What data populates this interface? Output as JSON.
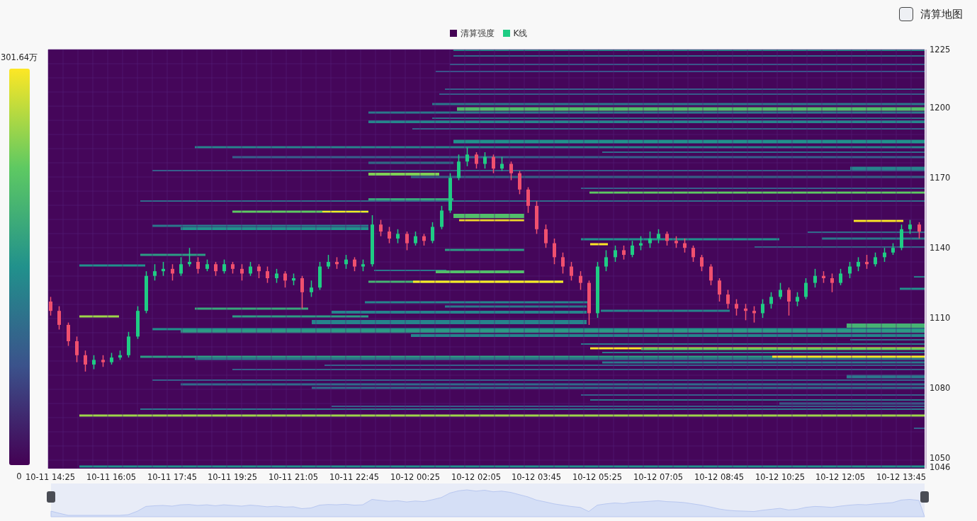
{
  "toggle": {
    "label": "清算地图",
    "checked": false
  },
  "legend": [
    {
      "label": "清算强度",
      "color": "#440154"
    },
    {
      "label": "K线",
      "color": "#1fcc84"
    }
  ],
  "color_scale": {
    "max_label": "301.64万",
    "min_label": "0"
  },
  "chart_data": {
    "type": "candlestick",
    "categories": [
      "10-11 14:25",
      null,
      null,
      null,
      null,
      null,
      null,
      "10-11 16:05",
      null,
      null,
      null,
      null,
      null,
      null,
      "10-11 17:45",
      null,
      null,
      null,
      null,
      null,
      null,
      "10-11 19:25",
      null,
      null,
      null,
      null,
      null,
      null,
      "10-11 21:05",
      null,
      null,
      null,
      null,
      null,
      null,
      "10-11 22:45",
      null,
      null,
      null,
      null,
      null,
      null,
      "10-12 00:25",
      null,
      null,
      null,
      null,
      null,
      null,
      "10-12 02:05",
      null,
      null,
      null,
      null,
      null,
      null,
      "10-12 03:45",
      null,
      null,
      null,
      null,
      null,
      null,
      "10-12 05:25",
      null,
      null,
      null,
      null,
      null,
      null,
      "10-12 07:05",
      null,
      null,
      null,
      null,
      null,
      null,
      "10-12 08:45",
      null,
      null,
      null,
      null,
      null,
      null,
      "10-12 10:25",
      null,
      null,
      null,
      null,
      null,
      null,
      "10-12 12:05",
      null,
      null,
      null,
      null,
      null,
      null,
      "10-12 13:45",
      null,
      null
    ],
    "ohlc": [
      [
        1117,
        1119,
        1111,
        1113
      ],
      [
        1113,
        1115,
        1105,
        1107
      ],
      [
        1107,
        1108,
        1098,
        1100
      ],
      [
        1100,
        1102,
        1091,
        1094
      ],
      [
        1094,
        1096,
        1087,
        1090
      ],
      [
        1090,
        1094,
        1088,
        1092
      ],
      [
        1092,
        1094,
        1089,
        1091
      ],
      [
        1091,
        1095,
        1090,
        1093
      ],
      [
        1093,
        1096,
        1092,
        1094
      ],
      [
        1094,
        1104,
        1093,
        1102
      ],
      [
        1102,
        1115,
        1101,
        1113
      ],
      [
        1113,
        1130,
        1112,
        1128
      ],
      [
        1128,
        1133,
        1126,
        1130
      ],
      [
        1130,
        1134,
        1128,
        1131
      ],
      [
        1131,
        1133,
        1126,
        1129
      ],
      [
        1129,
        1136,
        1128,
        1133
      ],
      [
        1133,
        1140,
        1132,
        1134
      ],
      [
        1134,
        1136,
        1129,
        1131
      ],
      [
        1131,
        1135,
        1130,
        1133
      ],
      [
        1133,
        1134,
        1128,
        1130
      ],
      [
        1130,
        1135,
        1129,
        1133
      ],
      [
        1133,
        1134,
        1129,
        1131
      ],
      [
        1131,
        1133,
        1126,
        1129
      ],
      [
        1129,
        1134,
        1128,
        1132
      ],
      [
        1132,
        1133,
        1127,
        1130
      ],
      [
        1130,
        1132,
        1125,
        1127
      ],
      [
        1127,
        1131,
        1125,
        1129
      ],
      [
        1129,
        1130,
        1123,
        1126
      ],
      [
        1126,
        1129,
        1124,
        1127
      ],
      [
        1127,
        1128,
        1114,
        1121
      ],
      [
        1121,
        1126,
        1119,
        1123
      ],
      [
        1123,
        1134,
        1122,
        1132
      ],
      [
        1132,
        1137,
        1131,
        1134
      ],
      [
        1134,
        1136,
        1131,
        1133
      ],
      [
        1133,
        1137,
        1131,
        1135
      ],
      [
        1135,
        1136,
        1130,
        1132
      ],
      [
        1132,
        1135,
        1130,
        1133
      ],
      [
        1133,
        1154,
        1132,
        1150
      ],
      [
        1150,
        1152,
        1145,
        1147
      ],
      [
        1147,
        1149,
        1142,
        1144
      ],
      [
        1144,
        1148,
        1142,
        1146
      ],
      [
        1146,
        1147,
        1139,
        1142
      ],
      [
        1142,
        1147,
        1141,
        1145
      ],
      [
        1145,
        1146,
        1141,
        1143
      ],
      [
        1143,
        1151,
        1142,
        1149
      ],
      [
        1149,
        1158,
        1148,
        1156
      ],
      [
        1156,
        1172,
        1155,
        1170
      ],
      [
        1170,
        1180,
        1169,
        1177
      ],
      [
        1177,
        1183,
        1175,
        1180
      ],
      [
        1180,
        1181,
        1174,
        1176
      ],
      [
        1176,
        1181,
        1174,
        1179
      ],
      [
        1179,
        1180,
        1172,
        1174
      ],
      [
        1174,
        1179,
        1173,
        1176
      ],
      [
        1176,
        1177,
        1169,
        1172
      ],
      [
        1172,
        1173,
        1163,
        1165
      ],
      [
        1165,
        1166,
        1155,
        1158
      ],
      [
        1158,
        1160,
        1146,
        1148
      ],
      [
        1148,
        1150,
        1140,
        1142
      ],
      [
        1142,
        1144,
        1133,
        1136
      ],
      [
        1136,
        1138,
        1129,
        1132
      ],
      [
        1132,
        1134,
        1126,
        1128
      ],
      [
        1128,
        1130,
        1122,
        1125
      ],
      [
        1125,
        1126,
        1107,
        1112
      ],
      [
        1112,
        1134,
        1110,
        1132
      ],
      [
        1132,
        1139,
        1130,
        1136
      ],
      [
        1136,
        1141,
        1134,
        1139
      ],
      [
        1139,
        1141,
        1135,
        1137
      ],
      [
        1137,
        1143,
        1136,
        1141
      ],
      [
        1141,
        1145,
        1139,
        1142
      ],
      [
        1142,
        1147,
        1140,
        1144
      ],
      [
        1144,
        1148,
        1142,
        1146
      ],
      [
        1146,
        1147,
        1141,
        1143
      ],
      [
        1143,
        1145,
        1140,
        1142
      ],
      [
        1142,
        1144,
        1138,
        1140
      ],
      [
        1140,
        1141,
        1134,
        1136
      ],
      [
        1136,
        1137,
        1130,
        1132
      ],
      [
        1132,
        1133,
        1124,
        1126
      ],
      [
        1126,
        1127,
        1117,
        1120
      ],
      [
        1120,
        1122,
        1114,
        1116
      ],
      [
        1116,
        1118,
        1111,
        1114
      ],
      [
        1114,
        1116,
        1109,
        1113
      ],
      [
        1113,
        1115,
        1108,
        1112
      ],
      [
        1112,
        1118,
        1110,
        1116
      ],
      [
        1116,
        1121,
        1114,
        1119
      ],
      [
        1119,
        1125,
        1118,
        1122
      ],
      [
        1122,
        1123,
        1111,
        1117
      ],
      [
        1117,
        1121,
        1115,
        1119
      ],
      [
        1119,
        1127,
        1118,
        1125
      ],
      [
        1125,
        1131,
        1123,
        1128
      ],
      [
        1128,
        1130,
        1125,
        1127
      ],
      [
        1127,
        1129,
        1121,
        1125
      ],
      [
        1125,
        1131,
        1124,
        1129
      ],
      [
        1129,
        1134,
        1127,
        1132
      ],
      [
        1132,
        1136,
        1130,
        1134
      ],
      [
        1134,
        1137,
        1131,
        1133
      ],
      [
        1133,
        1138,
        1132,
        1136
      ],
      [
        1136,
        1140,
        1134,
        1138
      ],
      [
        1138,
        1142,
        1137,
        1140
      ],
      [
        1140,
        1150,
        1139,
        1148
      ],
      [
        1148,
        1152,
        1146,
        1150
      ],
      [
        1150,
        1151,
        1144,
        1147
      ]
    ],
    "ylim": [
      1046,
      1225
    ],
    "grid": true,
    "yticks": [
      1225,
      1200,
      1170,
      1140,
      1110,
      1080,
      1050,
      1046
    ]
  }
}
